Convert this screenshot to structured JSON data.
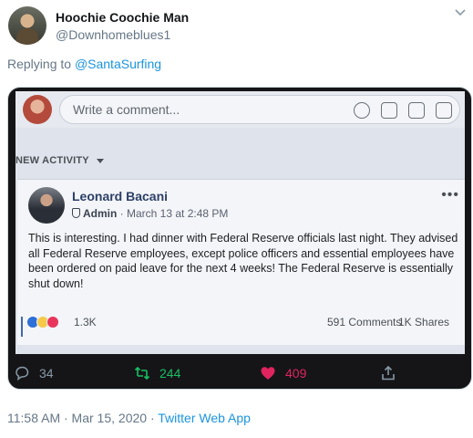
{
  "tweet": {
    "author_name": "Hoochie Coochie Man",
    "author_handle": "@Downhomeblues1",
    "replying_prefix": "Replying to ",
    "replying_to": "@SantaSurfing",
    "timestamp": "11:58 AM · Mar 15, 2020",
    "separator": " · ",
    "source_app": "Twitter Web App"
  },
  "photo": {
    "comment_placeholder": "Write a comment...",
    "activity_label": "NEW ACTIVITY",
    "post": {
      "author": "Leonard Bacani",
      "role": "Admin",
      "meta": " · March 13 at 2:48 PM",
      "body": "This is interesting. I had dinner with Federal Reserve officials last night. They advised all Federal Reserve employees, except police officers and essential employees have been ordered on paid leave for the next 4 weeks! The Federal Reserve is essentially shut down!",
      "reactions": "1.3K",
      "comments": "591 Comments",
      "shares": "1K Shares"
    }
  },
  "actions": {
    "replies": "34",
    "retweets": "244",
    "likes": "409"
  },
  "colors": {
    "link": "#1b95e0",
    "retweet": "#17bf63",
    "like": "#e0245e",
    "muted": "#657786"
  }
}
